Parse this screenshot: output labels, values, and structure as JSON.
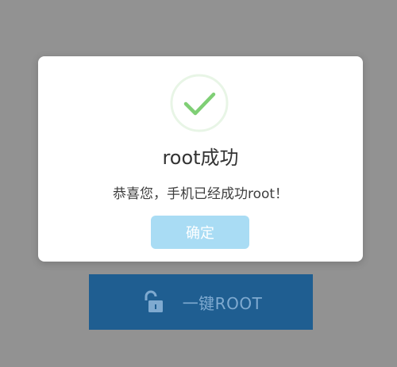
{
  "background_button": {
    "label": "一键ROOT",
    "icon": "unlock-icon",
    "color": "#1f5e91"
  },
  "dialog": {
    "icon": "success-check-icon",
    "title": "root成功",
    "message": "恭喜您，手机已经成功root！",
    "confirm_label": "确定",
    "accent_color": "#7fcf75",
    "confirm_color": "#a9dcf4"
  }
}
